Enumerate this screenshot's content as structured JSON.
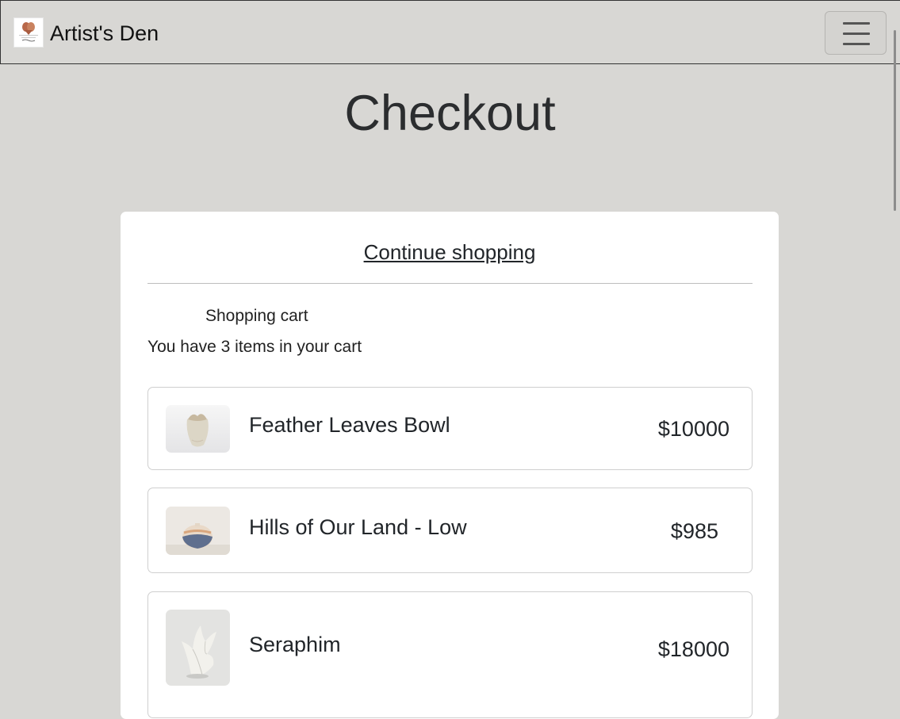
{
  "navbar": {
    "brand_name": "Artist's Den",
    "logo_icon": "pottery-logo-icon",
    "menu_icon": "hamburger-menu-icon"
  },
  "page": {
    "title": "Checkout"
  },
  "cart": {
    "continue_label": "Continue shopping",
    "heading": "Shopping cart",
    "count_text": "You have 3 items in your cart",
    "items": [
      {
        "name": "Feather Leaves Bowl",
        "price": "$10000"
      },
      {
        "name": "Hills of Our Land - Low",
        "price": "$985"
      },
      {
        "name": "Seraphim",
        "price": "$18000"
      }
    ]
  },
  "colors": {
    "background": "#d8d7d4",
    "card": "#ffffff",
    "text": "#212529"
  }
}
